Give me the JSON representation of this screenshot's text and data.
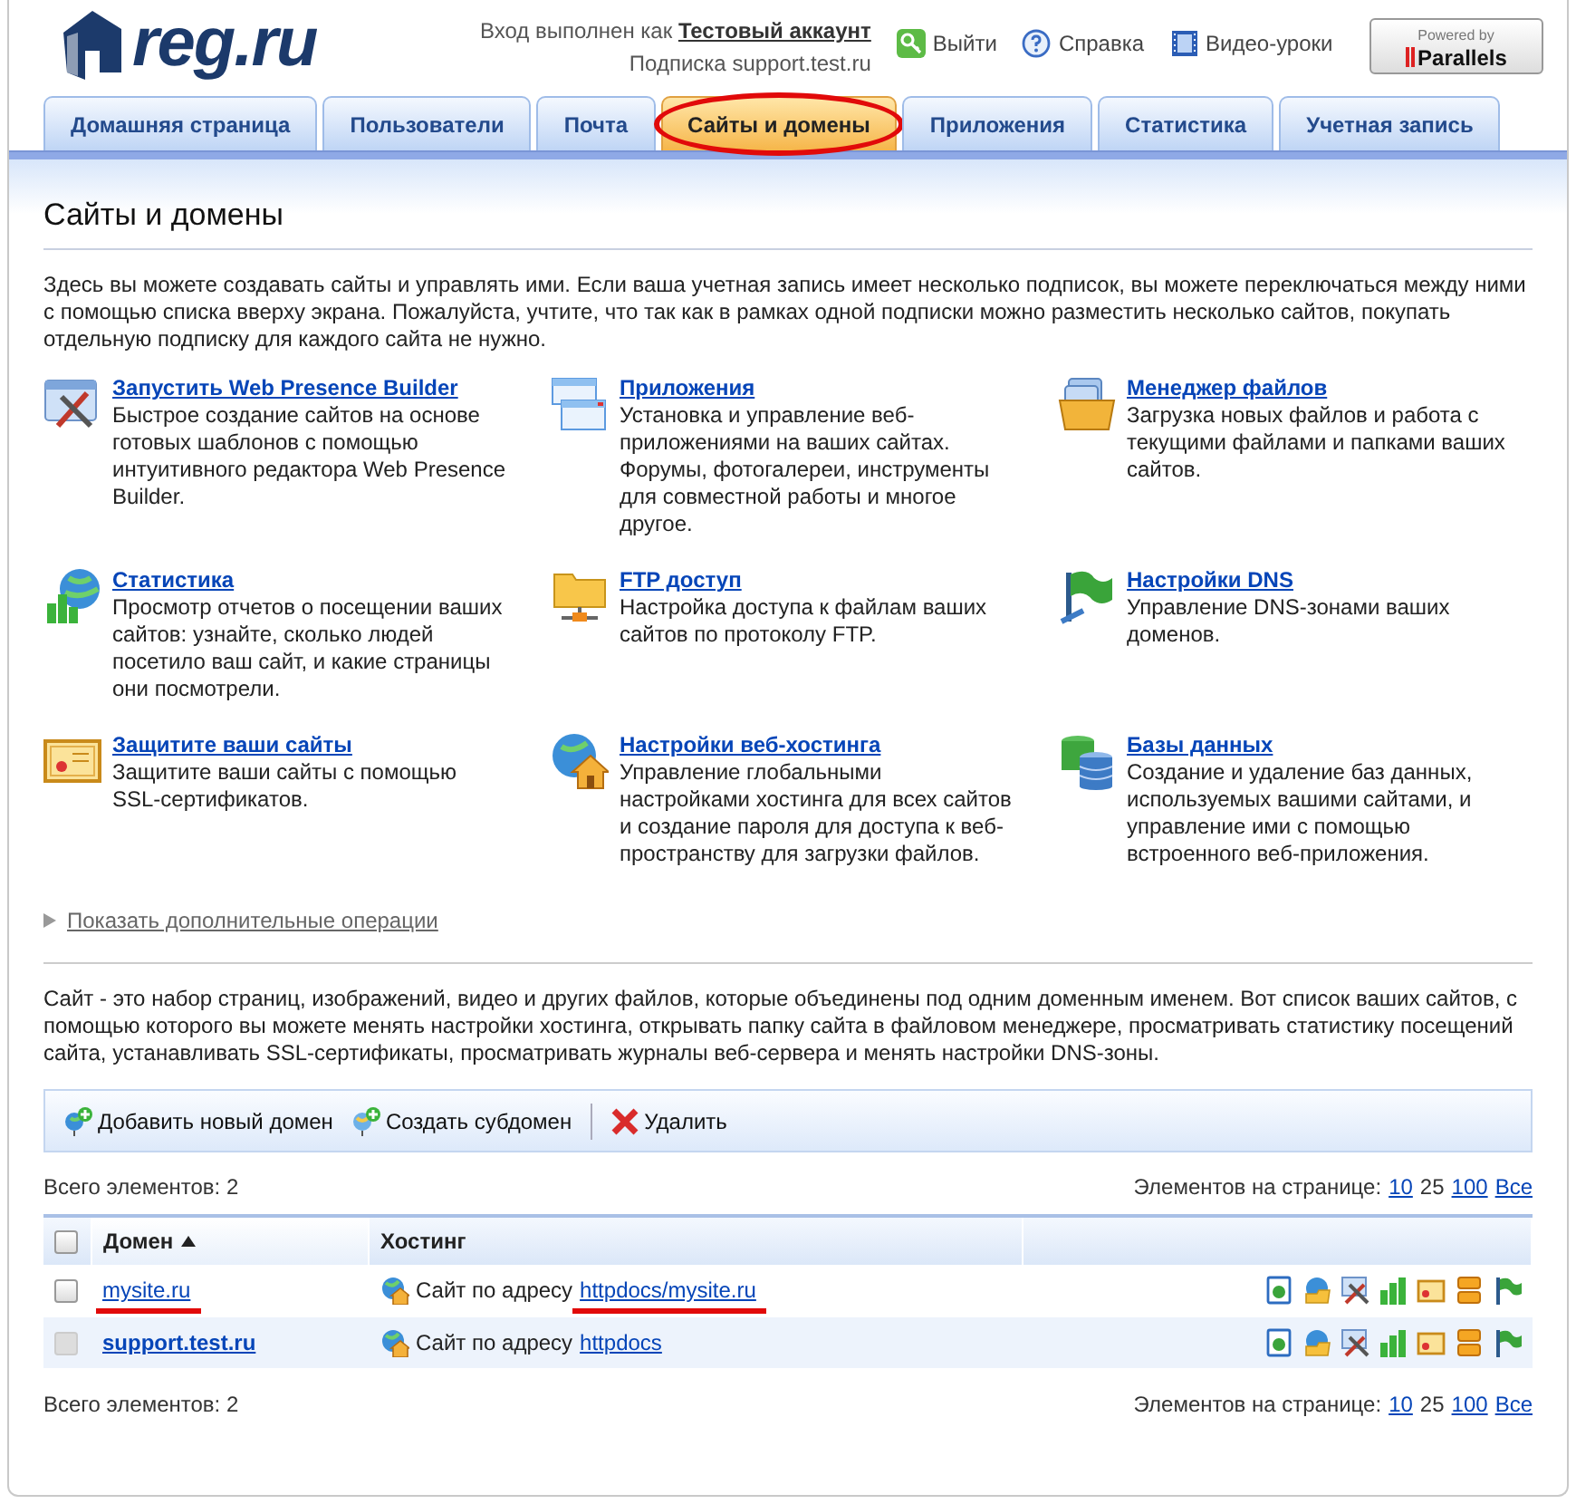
{
  "header": {
    "logo": "reg.ru",
    "login_label": "Вход выполнен как",
    "account": "Тестовый аккаунт",
    "subscription_label": "Подписка",
    "subscription": "support.test.ru",
    "links": [
      "Выйти",
      "Справка",
      "Видео-уроки"
    ],
    "powered_by": "Powered by",
    "parallels": "Parallels"
  },
  "tabs": [
    {
      "label": "Домашняя страница",
      "selected": false,
      "circled": false
    },
    {
      "label": "Пользователи",
      "selected": false,
      "circled": false
    },
    {
      "label": "Почта",
      "selected": false,
      "circled": false
    },
    {
      "label": "Сайты и домены",
      "selected": true,
      "circled": true
    },
    {
      "label": "Приложения",
      "selected": false,
      "circled": false
    },
    {
      "label": "Статистика",
      "selected": false,
      "circled": false
    },
    {
      "label": "Учетная запись",
      "selected": false,
      "circled": false
    }
  ],
  "page_title": "Сайты и домены",
  "intro": "Здесь вы можете создавать сайты и управлять ими. Если ваша учетная запись имеет несколько подписок, вы можете переключаться между ними с помощью списка вверху экрана. Пожалуйста, учтите, что так как в рамках одной подписки можно разместить несколько сайтов, покупать отдельную подписку для каждого сайта не нужно.",
  "features": [
    {
      "title": "Запустить Web Presence Builder",
      "description": "Быстрое создание сайтов на основе готовых шаблонов с помощью интуитивного редактора Web Presence Builder."
    },
    {
      "title": "Приложения",
      "description": "Установка и управление веб-приложениями на ваших сайтах. Форумы, фотогалереи, инструменты для совместной работы и многое другое."
    },
    {
      "title": "Менеджер файлов",
      "description": "Загрузка новых файлов и работа с текущими файлами и папками ваших сайтов."
    },
    {
      "title": "Статистика",
      "description": "Просмотр отчетов о посещении ваших сайтов: узнайте, сколько людей посетило ваш сайт, и какие страницы они посмотрели."
    },
    {
      "title": "FTP доступ",
      "description": "Настройка доступа к файлам ваших сайтов по протоколу FTP."
    },
    {
      "title": "Настройки DNS",
      "description": "Управление DNS-зонами ваших доменов."
    },
    {
      "title": "Защитите ваши сайты",
      "description": "Защитите ваши сайты с помощью SSL-сертификатов."
    },
    {
      "title": "Настройки веб-хостинга",
      "description": "Управление глобальными настройками хостинга для всех сайтов и создание пароля для доступа к веб-пространству для загрузки файлов."
    },
    {
      "title": "Базы данных",
      "description": "Создание и удаление баз данных, используемых вашими сайтами, и управление ими с помощью встроенного веб-приложения."
    }
  ],
  "more_link": "Показать дополнительные операции",
  "sites_intro": "Сайт - это набор страниц, изображений, видео и других файлов, которые объединены под одним доменным именем. Вот список ваших сайтов, с помощью которого вы можете менять настройки хостинга, открывать папку сайта в файловом менеджере, просматривать статистику посещений сайта, устанавливать SSL-сертификаты, просматривать журналы веб-сервера и менять настройки DNS-зоны.",
  "toolbar": [
    "Добавить новый домен",
    "Создать субдомен",
    "Удалить"
  ],
  "pager_top": {
    "total": "Всего элементов: 2",
    "label": "Элементов на странице:",
    "options": [
      {
        "label": "10",
        "selected": false
      },
      {
        "label": "25",
        "selected": true
      },
      {
        "label": "100",
        "selected": false
      },
      {
        "label": "Все",
        "selected": false
      }
    ]
  },
  "table": {
    "select_all_checked": false,
    "columns": [
      {
        "label": "Домен",
        "sorted": true
      },
      {
        "label": "Хостинг",
        "sorted": false
      }
    ],
    "rows": [
      {
        "domain": "mysite.ru",
        "bold": false,
        "checkbox_disabled": false,
        "domain_underlined": true,
        "hosting_label": "Сайт по адресу",
        "hosting_link": "httpdocs/mysite.ru",
        "hosting_underlined": true
      },
      {
        "domain": "support.test.ru",
        "bold": true,
        "checkbox_disabled": true,
        "domain_underlined": false,
        "hosting_label": "Сайт по адресу",
        "hosting_link": "httpdocs",
        "hosting_underlined": false
      }
    ]
  },
  "pager_bottom": {
    "total": "Всего элементов: 2",
    "label": "Элементов на странице:",
    "options": [
      {
        "label": "10",
        "selected": false
      },
      {
        "label": "25",
        "selected": true
      },
      {
        "label": "100",
        "selected": false
      },
      {
        "label": "Все",
        "selected": false
      }
    ]
  }
}
